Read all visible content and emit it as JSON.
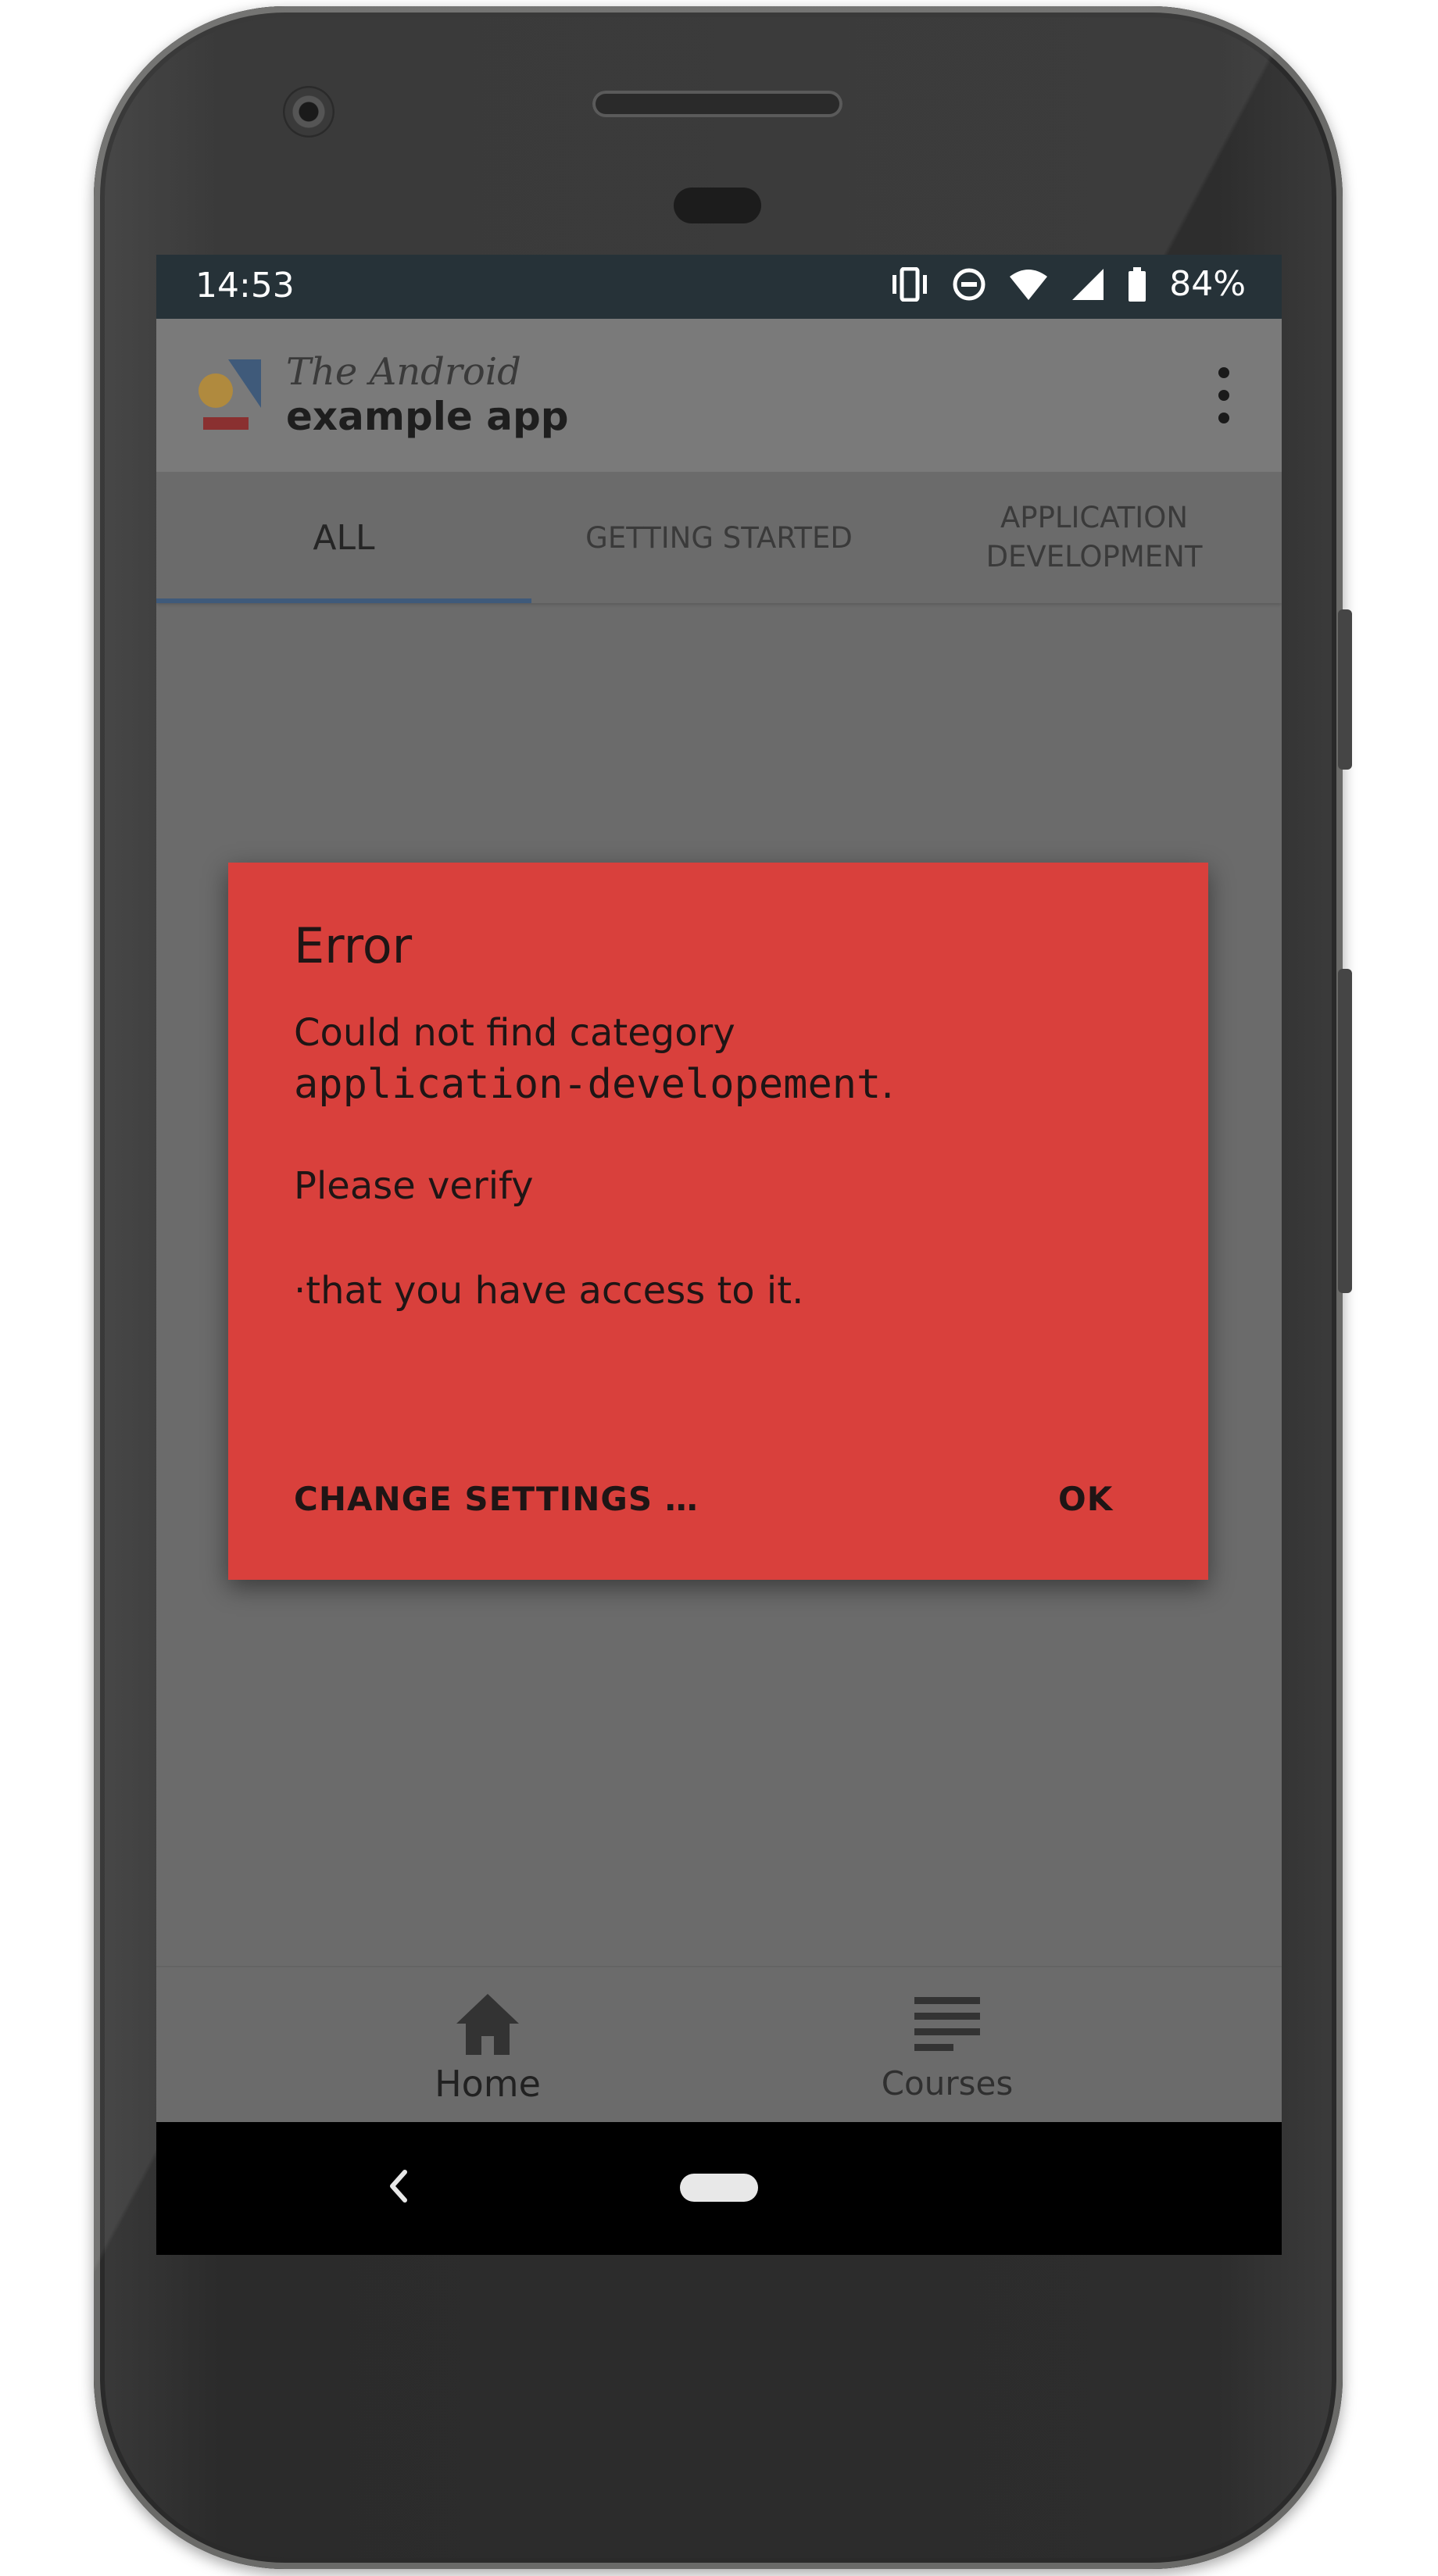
{
  "status_bar": {
    "time": "14:53",
    "battery": "84%",
    "icons": [
      "vibrate-icon",
      "dnd-icon",
      "wifi-icon",
      "signal-icon",
      "battery-icon"
    ]
  },
  "app_bar": {
    "title_line1": "The Android",
    "title_line2": "example app",
    "menu_icon": "overflow-menu-icon"
  },
  "tabs": [
    {
      "label": "ALL",
      "selected": true
    },
    {
      "label": "GETTING STARTED",
      "selected": false
    },
    {
      "label_line1": "APPLICATION",
      "label_line2": "DEVELOPMENT",
      "selected": false
    }
  ],
  "dialog": {
    "title": "Error",
    "line1": "Could not find category",
    "code": "application-developement",
    "code_suffix": ".",
    "line3": "Please verify",
    "line4": "·that you have access to it.",
    "button_secondary": "CHANGE SETTINGS …",
    "button_primary": "OK",
    "background_color": "#d9403c"
  },
  "bottom_nav": [
    {
      "label": "Home",
      "icon": "home-icon"
    },
    {
      "label": "Courses",
      "icon": "list-icon"
    }
  ],
  "system_nav": {
    "back_icon": "back-chevron-icon",
    "home_icon": "home-pill-icon"
  }
}
